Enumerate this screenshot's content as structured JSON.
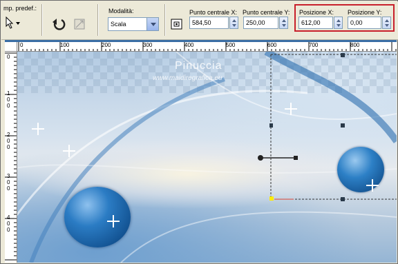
{
  "toolbar": {
    "preset_label": "mp. predef.:",
    "mode_label": "Modalità:",
    "mode_value": "Scala",
    "center_x_label": "Punto centrale X:",
    "center_x_value": "584,50",
    "center_y_label": "Punto centrale Y:",
    "center_y_value": "250,00",
    "pos_x_label": "Posizione X:",
    "pos_x_value": "612,00",
    "pos_y_label": "Posizione Y:",
    "pos_y_value": "0,00"
  },
  "ruler": {
    "top_ticks": [
      "0",
      "100",
      "200",
      "300",
      "400",
      "500",
      "600",
      "700",
      "800"
    ],
    "left_ticks": [
      "0",
      "1\n0\n0",
      "2\n0\n0",
      "3\n0\n0",
      "4\n0\n0"
    ]
  },
  "canvas": {
    "watermark_title": "Pinuccia",
    "watermark_url": "www.maidiregrafica.eu"
  },
  "colors": {
    "highlight": "#c81e2a",
    "sphere": "#1f6fb8"
  }
}
